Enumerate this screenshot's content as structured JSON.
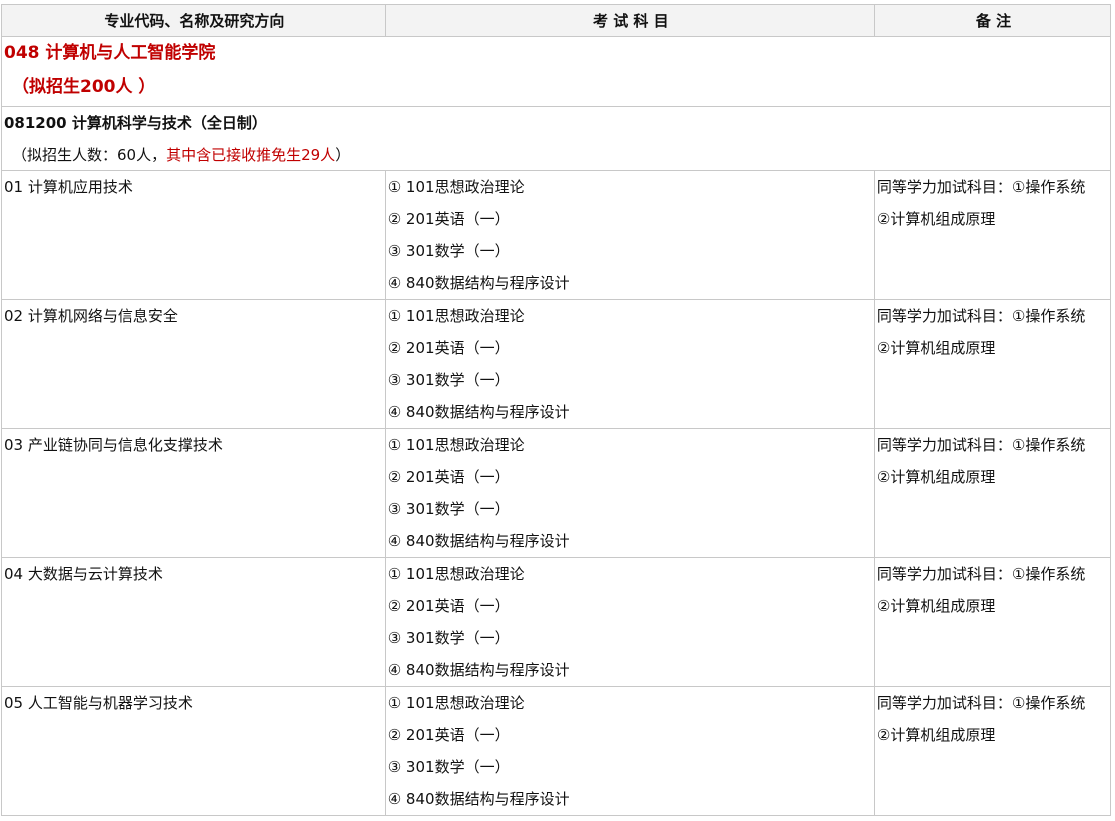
{
  "header": {
    "col1": "专业代码、名称及研究方向",
    "col2": "考 试 科 目",
    "col3": "备 注"
  },
  "department": {
    "line1": "048 计算机与人工智能学院",
    "line2": "（拟招生200人 ）"
  },
  "major": {
    "title": "081200 计算机科学与技术（全日制）",
    "enroll_prefix": "（拟招生人数：60人，",
    "enroll_red": "其中含已接收推免生29人",
    "enroll_suffix": "）"
  },
  "directions": [
    {
      "name": "01 计算机应用技术",
      "subjects": [
        "① 101思想政治理论",
        "② 201英语（一）",
        "③ 301数学（一）",
        "④ 840数据结构与程序设计"
      ],
      "notes": [
        "同等学力加试科目：①操作系统",
        "②计算机组成原理"
      ]
    },
    {
      "name": "02 计算机网络与信息安全",
      "subjects": [
        "① 101思想政治理论",
        "② 201英语（一）",
        "③ 301数学（一）",
        "④ 840数据结构与程序设计"
      ],
      "notes": [
        "同等学力加试科目：①操作系统",
        "②计算机组成原理"
      ]
    },
    {
      "name": "03 产业链协同与信息化支撑技术",
      "subjects": [
        "① 101思想政治理论",
        "② 201英语（一）",
        "③ 301数学（一）",
        "④ 840数据结构与程序设计"
      ],
      "notes": [
        "同等学力加试科目：①操作系统",
        "②计算机组成原理"
      ]
    },
    {
      "name": "04 大数据与云计算技术",
      "subjects": [
        "① 101思想政治理论",
        "② 201英语（一）",
        "③ 301数学（一）",
        "④ 840数据结构与程序设计"
      ],
      "notes": [
        "同等学力加试科目：①操作系统",
        "②计算机组成原理"
      ]
    },
    {
      "name": "05 人工智能与机器学习技术",
      "subjects": [
        "① 101思想政治理论",
        "② 201英语（一）",
        "③ 301数学（一）",
        "④ 840数据结构与程序设计"
      ],
      "notes": [
        "同等学力加试科目：①操作系统",
        "②计算机组成原理"
      ]
    }
  ]
}
